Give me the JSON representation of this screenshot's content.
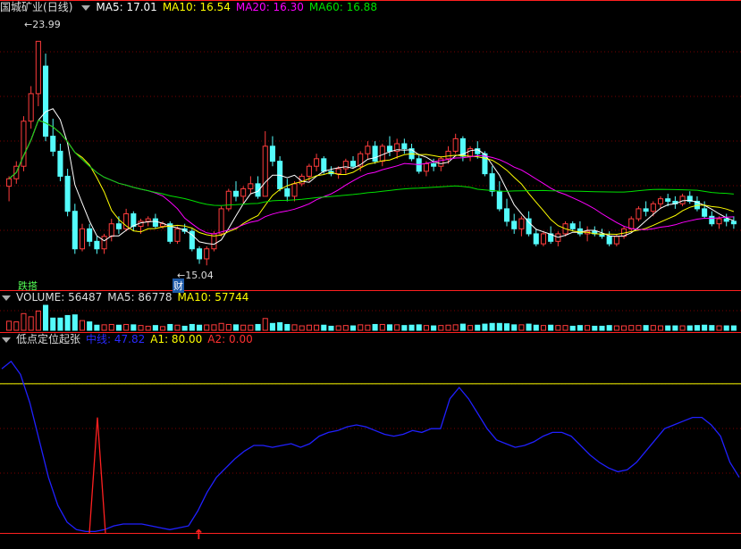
{
  "price_panel": {
    "stock_name": "国城矿业",
    "period": "(日线)",
    "ma5_label": "MA5: 17.01",
    "ma10_label": "MA10: 16.54",
    "ma20_label": "MA20: 16.30",
    "ma60_label": "MA60: 16.88",
    "high_label": "23.99",
    "low_label": "15.04",
    "tag_green": "跌搭",
    "tag_blue": "财"
  },
  "volume_panel": {
    "title": "VOLUME: 56487",
    "ma5_label": "MA5: 86778",
    "ma10_label": "MA10: 57744"
  },
  "indicator_panel": {
    "title": "低点定位起张",
    "v1_label": "中线: 47.82",
    "a1_label": "A1: 80.00",
    "a2_label": "A2: 0.00"
  },
  "colors": {
    "up": "#ff3c3c",
    "down": "#54fcfc",
    "ma5": "#ffffff",
    "ma10": "#ffff00",
    "ma20": "#ff00ff",
    "ma60": "#00e000",
    "indicator": "#2020ff",
    "a1": "#ffff00",
    "a2": "#ff2020",
    "grid": "#7a0000"
  },
  "chart_data": {
    "type": "candlestick",
    "price_range": [
      14.3,
      25.0
    ],
    "candles": [
      [
        18.2,
        18.6,
        17.6,
        18.5
      ],
      [
        18.5,
        19.2,
        18.3,
        19.0
      ],
      [
        19.0,
        21.0,
        18.8,
        20.8
      ],
      [
        20.8,
        22.2,
        20.5,
        21.9
      ],
      [
        21.9,
        24.0,
        21.4,
        23.99
      ],
      [
        23.0,
        23.5,
        20.0,
        20.2
      ],
      [
        20.2,
        20.9,
        19.4,
        19.6
      ],
      [
        19.6,
        19.9,
        18.4,
        18.6
      ],
      [
        18.6,
        18.9,
        17.0,
        17.2
      ],
      [
        17.2,
        17.5,
        15.5,
        15.7
      ],
      [
        15.7,
        16.7,
        15.6,
        16.5
      ],
      [
        16.5,
        16.7,
        15.8,
        16.0
      ],
      [
        16.0,
        16.2,
        15.5,
        15.7
      ],
      [
        15.7,
        16.3,
        15.5,
        16.2
      ],
      [
        16.2,
        16.9,
        16.0,
        16.7
      ],
      [
        16.7,
        17.0,
        16.3,
        16.5
      ],
      [
        16.5,
        17.3,
        16.4,
        17.1
      ],
      [
        17.1,
        17.2,
        16.4,
        16.6
      ],
      [
        16.6,
        16.9,
        16.3,
        16.8
      ],
      [
        16.8,
        17.0,
        16.6,
        16.9
      ],
      [
        16.9,
        17.1,
        16.5,
        16.6
      ],
      [
        16.6,
        16.8,
        16.5,
        16.7
      ],
      [
        16.7,
        16.8,
        15.9,
        16.0
      ],
      [
        16.0,
        16.6,
        15.9,
        16.5
      ],
      [
        16.5,
        16.7,
        16.3,
        16.4
      ],
      [
        16.4,
        16.5,
        15.6,
        15.7
      ],
      [
        15.7,
        15.8,
        15.1,
        15.3
      ],
      [
        15.3,
        15.8,
        15.04,
        15.7
      ],
      [
        15.7,
        16.4,
        15.6,
        16.3
      ],
      [
        16.3,
        17.4,
        16.2,
        17.3
      ],
      [
        17.3,
        18.1,
        17.2,
        18.0
      ],
      [
        18.0,
        18.4,
        17.6,
        17.8
      ],
      [
        17.8,
        18.2,
        17.5,
        18.1
      ],
      [
        18.1,
        18.6,
        17.9,
        18.3
      ],
      [
        18.3,
        18.6,
        17.7,
        17.8
      ],
      [
        17.8,
        20.4,
        17.8,
        19.8
      ],
      [
        19.8,
        20.2,
        19.0,
        19.2
      ],
      [
        19.2,
        19.4,
        18.0,
        18.1
      ],
      [
        18.1,
        18.5,
        17.6,
        17.8
      ],
      [
        17.8,
        18.4,
        17.6,
        18.3
      ],
      [
        18.3,
        18.7,
        18.2,
        18.6
      ],
      [
        18.6,
        19.1,
        18.4,
        19.0
      ],
      [
        19.0,
        19.5,
        18.8,
        19.3
      ],
      [
        19.3,
        19.4,
        18.7,
        18.8
      ],
      [
        18.8,
        19.0,
        18.6,
        18.7
      ],
      [
        18.7,
        19.0,
        18.5,
        18.9
      ],
      [
        18.9,
        19.3,
        18.7,
        19.2
      ],
      [
        19.2,
        19.4,
        18.9,
        19.0
      ],
      [
        19.0,
        19.6,
        18.8,
        19.5
      ],
      [
        19.5,
        20.0,
        19.3,
        19.8
      ],
      [
        19.8,
        20.0,
        19.1,
        19.2
      ],
      [
        19.2,
        19.9,
        19.0,
        19.8
      ],
      [
        19.8,
        20.2,
        19.4,
        19.6
      ],
      [
        19.6,
        20.1,
        19.3,
        19.9
      ],
      [
        19.9,
        20.1,
        19.5,
        19.7
      ],
      [
        19.7,
        19.9,
        19.2,
        19.3
      ],
      [
        19.3,
        19.5,
        18.7,
        18.8
      ],
      [
        18.8,
        19.2,
        18.6,
        19.1
      ],
      [
        19.1,
        19.3,
        18.8,
        19.0
      ],
      [
        19.0,
        19.4,
        18.8,
        19.3
      ],
      [
        19.3,
        19.8,
        19.1,
        19.6
      ],
      [
        19.6,
        20.3,
        19.5,
        20.1
      ],
      [
        20.1,
        20.2,
        19.2,
        19.4
      ],
      [
        19.4,
        19.8,
        19.2,
        19.7
      ],
      [
        19.7,
        20.0,
        19.3,
        19.5
      ],
      [
        19.5,
        19.6,
        18.6,
        18.7
      ],
      [
        18.7,
        19.0,
        17.8,
        18.0
      ],
      [
        18.0,
        18.4,
        17.2,
        17.3
      ],
      [
        17.3,
        17.7,
        16.6,
        16.8
      ],
      [
        16.8,
        17.1,
        16.3,
        16.5
      ],
      [
        16.5,
        17.0,
        16.2,
        16.9
      ],
      [
        16.9,
        17.2,
        16.2,
        16.3
      ],
      [
        16.3,
        16.5,
        15.8,
        15.9
      ],
      [
        15.9,
        16.4,
        15.8,
        16.3
      ],
      [
        16.3,
        16.6,
        15.9,
        16.0
      ],
      [
        16.0,
        16.4,
        15.8,
        16.3
      ],
      [
        16.3,
        16.8,
        16.2,
        16.7
      ],
      [
        16.7,
        16.8,
        16.4,
        16.5
      ],
      [
        16.5,
        16.8,
        16.2,
        16.3
      ],
      [
        16.3,
        16.6,
        16.0,
        16.4
      ],
      [
        16.4,
        16.6,
        16.2,
        16.3
      ],
      [
        16.3,
        16.5,
        16.1,
        16.2
      ],
      [
        16.2,
        16.4,
        15.8,
        15.9
      ],
      [
        15.9,
        16.3,
        15.8,
        16.2
      ],
      [
        16.2,
        16.6,
        16.1,
        16.5
      ],
      [
        16.5,
        17.0,
        16.4,
        16.9
      ],
      [
        16.9,
        17.4,
        16.8,
        17.3
      ],
      [
        17.3,
        17.6,
        17.0,
        17.2
      ],
      [
        17.2,
        17.6,
        17.0,
        17.5
      ],
      [
        17.5,
        17.8,
        17.3,
        17.7
      ],
      [
        17.7,
        17.9,
        17.4,
        17.6
      ],
      [
        17.6,
        17.8,
        17.3,
        17.5
      ],
      [
        17.5,
        17.9,
        17.4,
        17.8
      ],
      [
        17.8,
        18.0,
        17.5,
        17.6
      ],
      [
        17.6,
        17.8,
        17.2,
        17.3
      ],
      [
        17.3,
        17.6,
        16.9,
        17.0
      ],
      [
        17.0,
        17.2,
        16.6,
        16.7
      ],
      [
        16.7,
        17.0,
        16.5,
        16.9
      ],
      [
        16.9,
        17.1,
        16.6,
        16.8
      ],
      [
        16.8,
        17.0,
        16.5,
        16.7
      ]
    ],
    "indicator_range": [
      -5,
      100
    ],
    "indicator": [
      88,
      92,
      85,
      70,
      50,
      30,
      15,
      6,
      2,
      1,
      1,
      2,
      4,
      5,
      5,
      5,
      4,
      3,
      2,
      3,
      4,
      12,
      22,
      30,
      35,
      40,
      44,
      47,
      47,
      46,
      47,
      48,
      46,
      48,
      52,
      54,
      55,
      57,
      58,
      57,
      55,
      53,
      52,
      53,
      55,
      54,
      56,
      56,
      72,
      78,
      72,
      64,
      56,
      50,
      48,
      46,
      47,
      49,
      52,
      54,
      54,
      52,
      47,
      42,
      38,
      35,
      33,
      34,
      38,
      44,
      50,
      56,
      58,
      60,
      62,
      62,
      58,
      52,
      38,
      30
    ],
    "a1": 80,
    "a2": 0
  }
}
